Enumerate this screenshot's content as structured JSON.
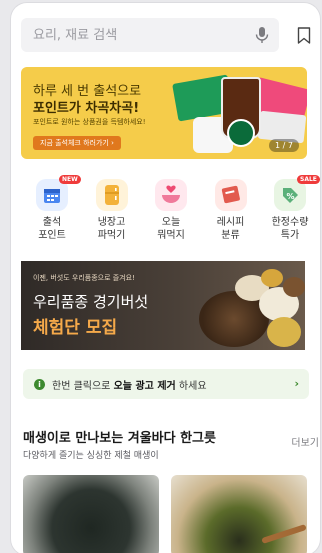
{
  "search": {
    "placeholder": "요리, 재료 검색"
  },
  "banner": {
    "line1": "하루 세 번 출석으로",
    "line2": "포인트가 차곡차곡!",
    "line3": "포인트로 원하는 상품권을 득템하세요!",
    "cta": "지금 출석체크 하러가기 ›",
    "counter": "1 / 7"
  },
  "categories": [
    {
      "label": "출석\n포인트",
      "badge": "NEW",
      "icon": "calendar-icon",
      "color": "#e6efff"
    },
    {
      "label": "냉장고\n파먹기",
      "badge": "",
      "icon": "fridge-icon",
      "color": "#fff3d9"
    },
    {
      "label": "오늘\n뭐먹지",
      "badge": "",
      "icon": "heart-bowl-icon",
      "color": "#ffe8ee"
    },
    {
      "label": "레시피\n분류",
      "badge": "",
      "icon": "book-icon",
      "color": "#ffe9e6"
    },
    {
      "label": "한정수량\n특가",
      "badge": "SALE",
      "icon": "discount-icon",
      "color": "#e8f5e3"
    }
  ],
  "promo": {
    "line1": "이젠, 버섯도 우리품종으로 즐겨요!",
    "line2": "우리품종 경기버섯",
    "line3": "체험단 모집"
  },
  "notice": {
    "prefix": "한번 클릭으로 ",
    "bold": "오늘 광고 제거",
    "suffix": " 하세요"
  },
  "section": {
    "title": "매생이로 만나보는 겨울바다 한그릇",
    "more": "더보기",
    "subtitle": "다양하게 즐기는 싱싱한 제철 매생이"
  }
}
